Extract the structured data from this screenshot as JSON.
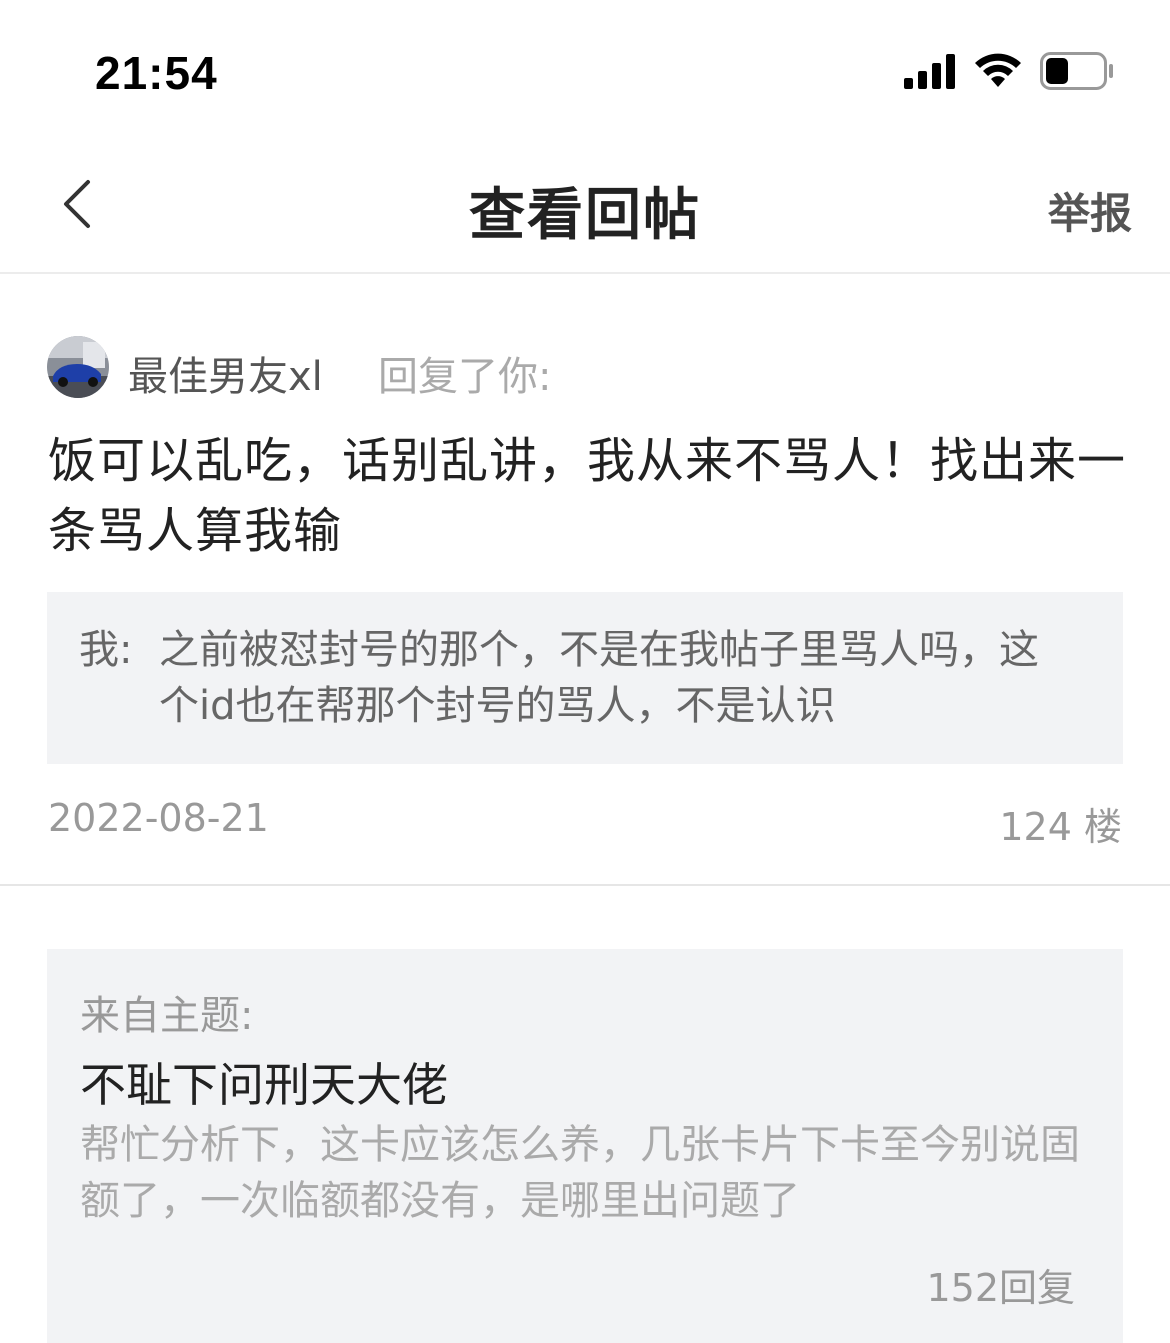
{
  "status_bar": {
    "time": "21:54"
  },
  "nav": {
    "title": "查看回帖",
    "report_label": "举报"
  },
  "reply": {
    "user_name": "最佳男友xl",
    "action_text": "回复了你:",
    "content": "饭可以乱吃，话别乱讲，我从来不骂人！找出来一条骂人算我输",
    "quote": {
      "prefix": "我:",
      "text": "之前被怼封号的那个，不是在我帖子里骂人吗，这个id也在帮那个封号的骂人，不是认识"
    },
    "date": "2022-08-21",
    "floor": "124 楼"
  },
  "topic": {
    "from_label": "来自主题:",
    "title": "不耻下问刑天大佬",
    "excerpt": "帮忙分析下，这卡应该怎么养，几张卡片下卡至今别说固额了，一次临额都没有，是哪里出问题了",
    "reply_count": "152回复"
  },
  "colors": {
    "background": "#ffffff",
    "quote_background": "#f2f3f5",
    "text_primary": "#222222",
    "text_secondary": "#999999"
  },
  "icons": {
    "back": "chevron-left-icon",
    "signal": "cellular-signal-icon",
    "wifi": "wifi-icon",
    "battery": "battery-icon"
  },
  "battery_level": 0.4
}
